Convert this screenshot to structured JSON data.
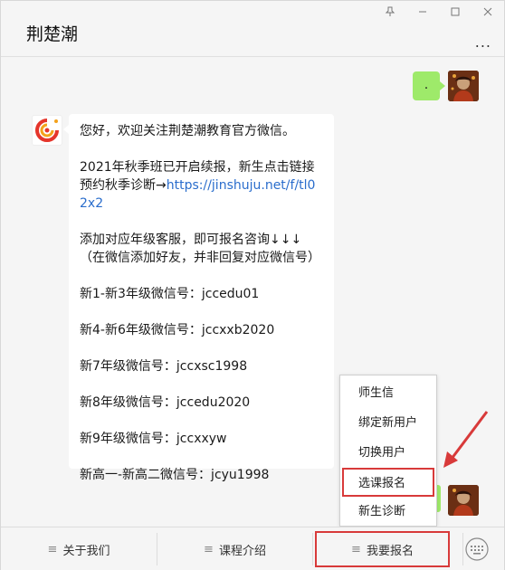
{
  "window": {
    "title": "荆楚潮",
    "controls": [
      "pin",
      "minimize",
      "maximize",
      "close"
    ],
    "more_label": "..."
  },
  "chat": {
    "me_message": ".",
    "them_message": {
      "p1": "您好，欢迎关注荆楚潮教育官方微信。",
      "p2_text": "2021年秋季班已开启续报，新生点击链接预约秋季诊断→",
      "p2_link": "https://jinshuju.net/f/tl02x2",
      "p3": "添加对应年级客服，即可报名咨询↓↓↓（在微信添加好友，并非回复对应微信号）",
      "p4": "新1-新3年级微信号：jccedu01",
      "p5": "新4-新6年级微信号：jccxxb2020",
      "p6": "新7年级微信号：jccxsc1998",
      "p7": "新8年级微信号：jccedu2020",
      "p8": "新9年级微信号：jccxxyw",
      "p9": "新高一-新高二微信号：jcyu1998"
    }
  },
  "popup_menu": {
    "items": [
      {
        "label": "师生信"
      },
      {
        "label": "绑定新用户"
      },
      {
        "label": "切换用户"
      },
      {
        "label": "选课报名"
      },
      {
        "label": "新生诊断"
      }
    ],
    "highlighted_index": 3
  },
  "bottom_menu": {
    "tabs": [
      {
        "label": "关于我们"
      },
      {
        "label": "课程介绍"
      },
      {
        "label": "我要报名"
      }
    ],
    "highlighted_index": 2
  },
  "colors": {
    "my_bubble": "#9eea6a",
    "highlight_border": "#d83a3a",
    "link": "#2a6dcc"
  }
}
